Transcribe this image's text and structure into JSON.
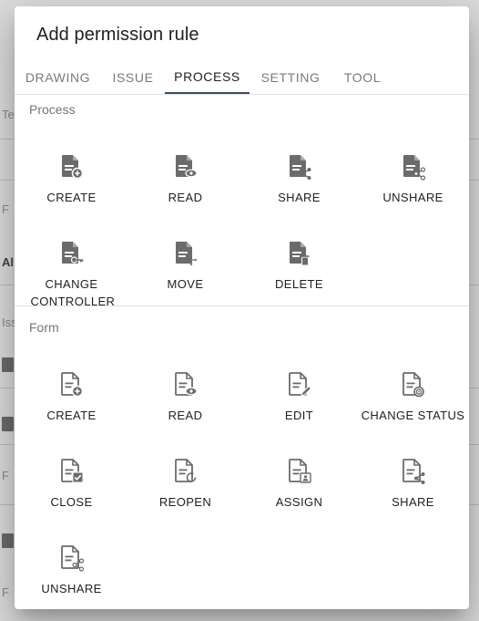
{
  "dialog": {
    "title": "Add permission rule",
    "tabs": [
      {
        "label": "DRAWING"
      },
      {
        "label": "ISSUE"
      },
      {
        "label": "PROCESS"
      },
      {
        "label": "SETTING"
      },
      {
        "label": "TOOL"
      }
    ],
    "active_tab": "PROCESS",
    "sections": {
      "process": {
        "title": "Process",
        "items": [
          {
            "label": "CREATE",
            "icon": "file-add-icon"
          },
          {
            "label": "READ",
            "icon": "file-eye-icon"
          },
          {
            "label": "SHARE",
            "icon": "file-share-icon"
          },
          {
            "label": "UNSHARE",
            "icon": "file-unshare-icon"
          },
          {
            "label": "CHANGE CONTROLLER",
            "icon": "file-key-icon"
          },
          {
            "label": "MOVE",
            "icon": "file-move-icon"
          },
          {
            "label": "DELETE",
            "icon": "file-delete-icon"
          }
        ]
      },
      "form": {
        "title": "Form",
        "items": [
          {
            "label": "CREATE",
            "icon": "form-add-icon"
          },
          {
            "label": "READ",
            "icon": "form-eye-icon"
          },
          {
            "label": "EDIT",
            "icon": "form-edit-icon"
          },
          {
            "label": "CHANGE STATUS",
            "icon": "form-status-icon"
          },
          {
            "label": "CLOSE",
            "icon": "form-check-icon"
          },
          {
            "label": "REOPEN",
            "icon": "form-reopen-icon"
          },
          {
            "label": "ASSIGN",
            "icon": "form-assign-icon"
          },
          {
            "label": "SHARE",
            "icon": "form-share-icon"
          },
          {
            "label": "UNSHARE",
            "icon": "form-unshare-icon"
          }
        ]
      }
    }
  },
  "background": {
    "fragments": [
      "Te",
      "F",
      "Al",
      "Iss",
      "F",
      "F"
    ]
  },
  "colors": {
    "icon": "#6b6b6b",
    "tab_indicator": "#3d4d63",
    "text": "#212121",
    "muted": "#757575"
  }
}
